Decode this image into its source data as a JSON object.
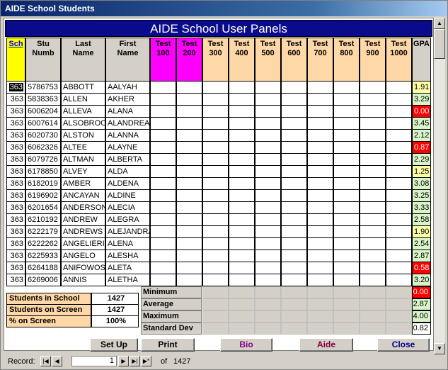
{
  "window": {
    "title": "AIDE School Students"
  },
  "banner": "AIDE School User Panels",
  "columns": [
    {
      "key": "sch",
      "label": "Sch",
      "bg": "#ffff00"
    },
    {
      "key": "stu",
      "label": "Stu\nNumb",
      "bg": "#d4d0c8"
    },
    {
      "key": "last",
      "label": "Last\nName",
      "bg": "#d4d0c8"
    },
    {
      "key": "first",
      "label": "First\nName",
      "bg": "#d4d0c8"
    },
    {
      "key": "t100",
      "label": "Test\n100",
      "bg": "#ff00ff"
    },
    {
      "key": "t200",
      "label": "Test\n200",
      "bg": "#ff00ff"
    },
    {
      "key": "t300",
      "label": "Test\n300",
      "bg": "#ffd8a8"
    },
    {
      "key": "t400",
      "label": "Test\n400",
      "bg": "#ffd8a8"
    },
    {
      "key": "t500",
      "label": "Test\n500",
      "bg": "#ffd8a8"
    },
    {
      "key": "t600",
      "label": "Test\n600",
      "bg": "#ffd8a8"
    },
    {
      "key": "t700",
      "label": "Test\n700",
      "bg": "#ffd8a8"
    },
    {
      "key": "t800",
      "label": "Test\n800",
      "bg": "#ffd8a8"
    },
    {
      "key": "t900",
      "label": "Test\n900",
      "bg": "#ffd8a8"
    },
    {
      "key": "t1000",
      "label": "Test\n1000",
      "bg": "#ffd8a8"
    },
    {
      "key": "gpa",
      "label": "GPA",
      "bg": "#d4d0c8"
    }
  ],
  "rows": [
    {
      "sch": "363",
      "stu": "5786753",
      "last": "ABBOTT",
      "first": "AALYAH",
      "gpa": "1.91",
      "gpa_class": "g-y"
    },
    {
      "sch": "363",
      "stu": "5838363",
      "last": "ALLEN",
      "first": "AKHER",
      "gpa": "3.29",
      "gpa_class": "g-g"
    },
    {
      "sch": "363",
      "stu": "6006204",
      "last": "ALLEVA",
      "first": "ALANA",
      "gpa": "0.00",
      "gpa_class": "g-r"
    },
    {
      "sch": "363",
      "stu": "6007614",
      "last": "ALSOBROO",
      "first": "ALANDREA",
      "gpa": "3.45",
      "gpa_class": "g-g"
    },
    {
      "sch": "363",
      "stu": "6020730",
      "last": "ALSTON",
      "first": "ALANNA",
      "gpa": "2.12",
      "gpa_class": "g-g"
    },
    {
      "sch": "363",
      "stu": "6062326",
      "last": "ALTEE",
      "first": "ALAYNE",
      "gpa": "0.87",
      "gpa_class": "g-r"
    },
    {
      "sch": "363",
      "stu": "6079726",
      "last": "ALTMAN",
      "first": "ALBERTA",
      "gpa": "2.29",
      "gpa_class": "g-g"
    },
    {
      "sch": "363",
      "stu": "6178850",
      "last": "ALVEY",
      "first": "ALDA",
      "gpa": "1.25",
      "gpa_class": "g-y"
    },
    {
      "sch": "363",
      "stu": "6182019",
      "last": "AMBER",
      "first": "ALDENA",
      "gpa": "3.08",
      "gpa_class": "g-g"
    },
    {
      "sch": "363",
      "stu": "6196902",
      "last": "ANCAYAN",
      "first": "ALDINE",
      "gpa": "3.25",
      "gpa_class": "g-g"
    },
    {
      "sch": "363",
      "stu": "6201654",
      "last": "ANDERSON",
      "first": "ALECIA",
      "gpa": "3.33",
      "gpa_class": "g-g"
    },
    {
      "sch": "363",
      "stu": "6210192",
      "last": "ANDREW",
      "first": "ALEGRA",
      "gpa": "2.58",
      "gpa_class": "g-g"
    },
    {
      "sch": "363",
      "stu": "6222179",
      "last": "ANDREWS",
      "first": "ALEJANDRA",
      "gpa": "1.90",
      "gpa_class": "g-y"
    },
    {
      "sch": "363",
      "stu": "6222262",
      "last": "ANGELIERI",
      "first": "ALENA",
      "gpa": "2.54",
      "gpa_class": "g-g"
    },
    {
      "sch": "363",
      "stu": "6225933",
      "last": "ANGELO",
      "first": "ALESHA",
      "gpa": "2.87",
      "gpa_class": "g-g"
    },
    {
      "sch": "363",
      "stu": "6264188",
      "last": "ANIFOWOSI",
      "first": "ALETA",
      "gpa": "0.58",
      "gpa_class": "g-r"
    },
    {
      "sch": "363",
      "stu": "6269006",
      "last": "ANNIS",
      "first": "ALETHA",
      "gpa": "3.20",
      "gpa_class": "g-g"
    }
  ],
  "stats": [
    {
      "label": "Students in School",
      "value": "1427"
    },
    {
      "label": "Students on Screen",
      "value": "1427"
    },
    {
      "label": "% on Screen",
      "value": "100%"
    }
  ],
  "aggregates": [
    {
      "label": "Minimum",
      "value": "0.00",
      "cls": "g-r"
    },
    {
      "label": "Average",
      "value": "2.87",
      "cls": "g-g"
    },
    {
      "label": "Maximum",
      "value": "4.00",
      "cls": "g-g"
    },
    {
      "label": "Standard Dev",
      "value": "0.82",
      "cls": ""
    }
  ],
  "buttons": [
    {
      "name": "setup-button",
      "label": "Set Up",
      "color": "#000000"
    },
    {
      "name": "print-button",
      "label": "Print",
      "color": "#000000"
    },
    {
      "name": "bio-button",
      "label": "Bio",
      "color": "#800080"
    },
    {
      "name": "aide-button",
      "label": "Aide",
      "color": "#800040"
    },
    {
      "name": "close-button",
      "label": "Close",
      "color": "#000080"
    }
  ],
  "nav": {
    "record_label": "Record:",
    "current": "1",
    "of_label": "of",
    "total": "1427"
  }
}
